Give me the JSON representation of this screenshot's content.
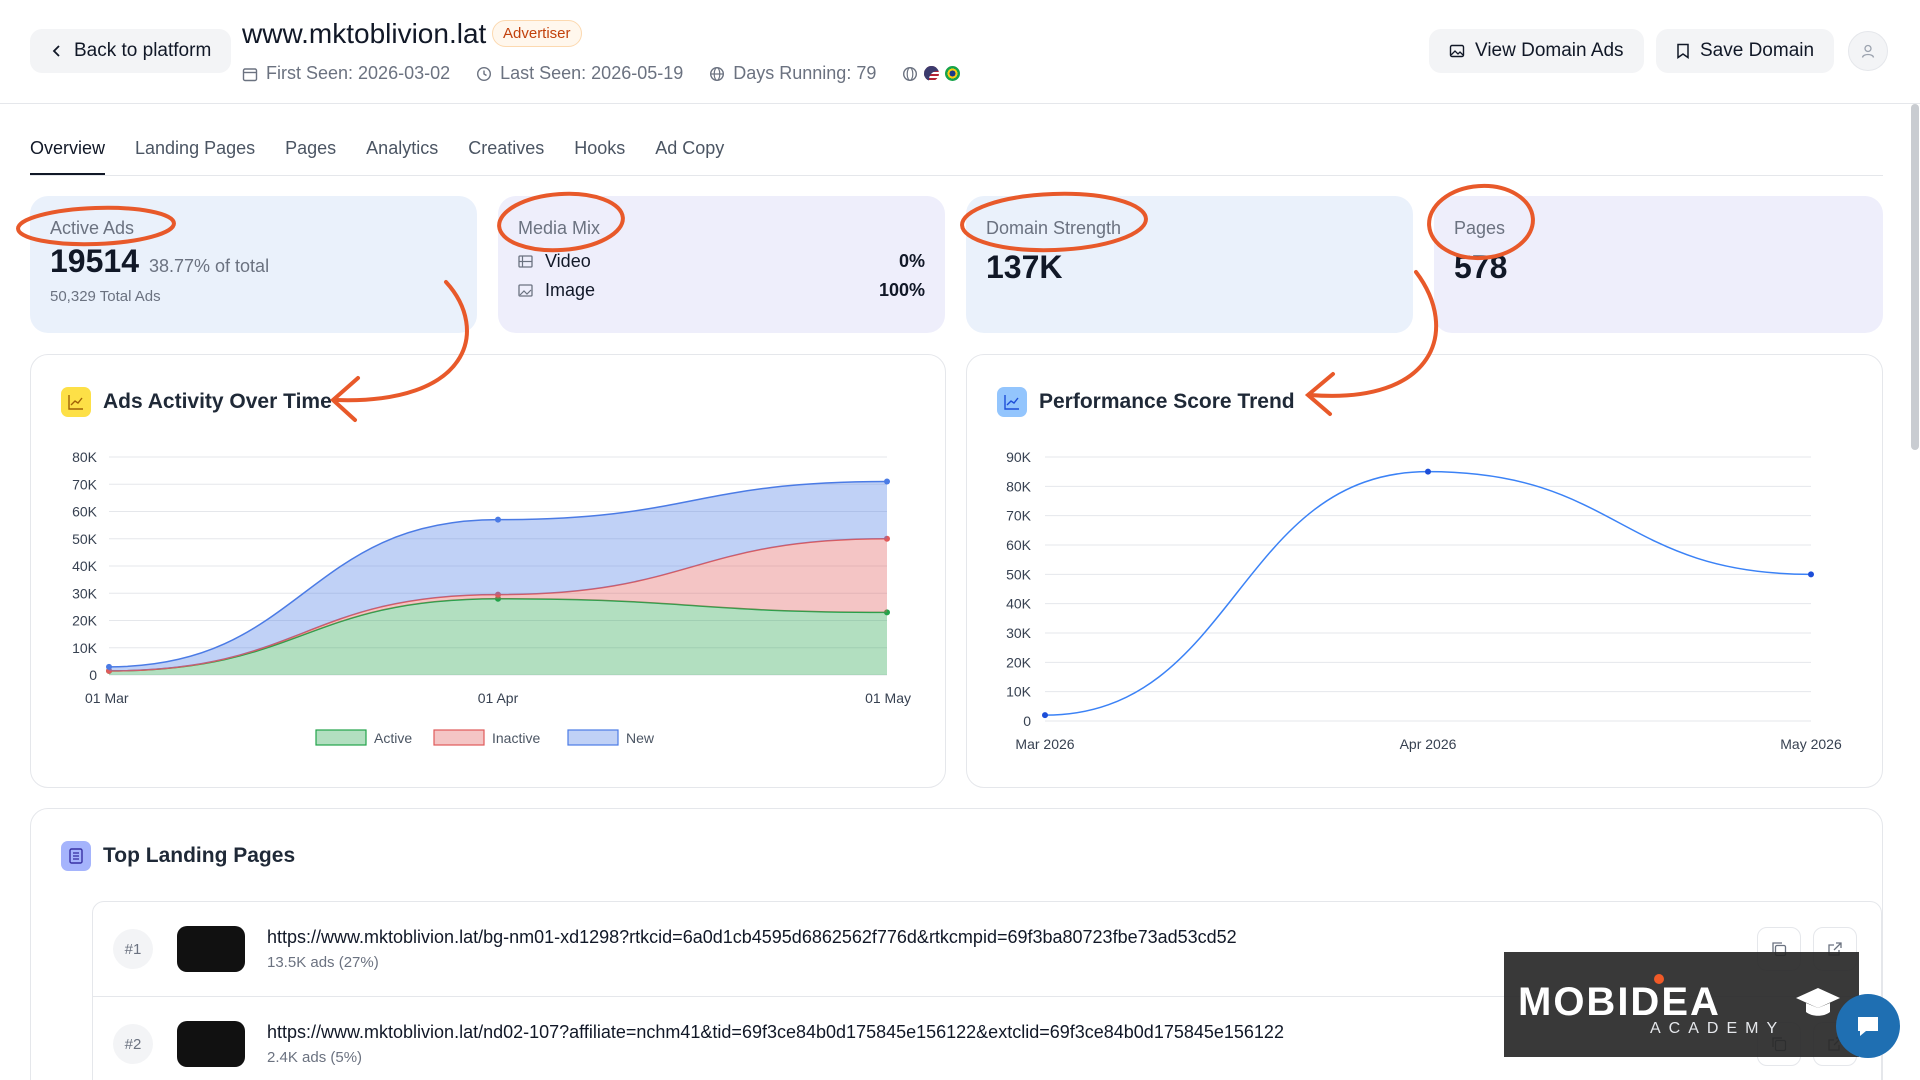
{
  "header": {
    "back_label": "Back to platform",
    "domain": "www.mktoblivion.lat",
    "badge": "Advertiser",
    "first_seen": "First Seen: 2026-03-02",
    "last_seen": "Last Seen: 2026-05-19",
    "days_running": "Days Running: 79",
    "view_ads_label": "View Domain Ads",
    "save_label": "Save Domain"
  },
  "tabs": [
    "Overview",
    "Landing Pages",
    "Pages",
    "Analytics",
    "Creatives",
    "Hooks",
    "Ad Copy"
  ],
  "stats": {
    "active_ads": {
      "label": "Active Ads",
      "value": "19514",
      "pct": "38.77% of total",
      "total": "50,329 Total Ads"
    },
    "media_mix": {
      "label": "Media Mix",
      "rows": [
        {
          "label": "Video",
          "value": "0%"
        },
        {
          "label": "Image",
          "value": "100%"
        }
      ]
    },
    "domain_strength": {
      "label": "Domain Strength",
      "value": "137K"
    },
    "pages": {
      "label": "Pages",
      "value": "578"
    }
  },
  "panels": {
    "ads_activity_title": "Ads Activity Over Time",
    "performance_title": "Performance Score Trend",
    "landing_title": "Top Landing Pages"
  },
  "chart_data": [
    {
      "type": "area",
      "title": "Ads Activity Over Time",
      "categories": [
        "01 Mar",
        "01 Apr",
        "01 May"
      ],
      "ylim": [
        0,
        80000
      ],
      "yticks": [
        "0",
        "10K",
        "20K",
        "30K",
        "40K",
        "50K",
        "60K",
        "70K",
        "80K"
      ],
      "stacked": true,
      "legend": "bottom",
      "grid": true,
      "series": [
        {
          "name": "Active",
          "values": [
            1500,
            28000,
            23000
          ],
          "color": "#22a34a"
        },
        {
          "name": "Inactive",
          "values": [
            0,
            1500,
            27000
          ],
          "color": "#e05a5a"
        },
        {
          "name": "New",
          "values": [
            1500,
            27500,
            21000
          ],
          "color": "#4b7be5"
        }
      ]
    },
    {
      "type": "line",
      "title": "Performance Score Trend",
      "categories": [
        "Mar 2026",
        "Apr 2026",
        "May 2026"
      ],
      "ylim": [
        0,
        90000
      ],
      "yticks": [
        "0",
        "10K",
        "20K",
        "30K",
        "40K",
        "50K",
        "60K",
        "70K",
        "80K",
        "90K"
      ],
      "grid": true,
      "series": [
        {
          "values": [
            2000,
            85000,
            50000
          ],
          "color": "#3b82f6"
        }
      ]
    }
  ],
  "landing_pages": [
    {
      "rank": "#1",
      "url": "https://www.mktoblivion.lat/bg-nm01-xd1298?rtkcid=6a0d1cb4595d6862562f776d&rtkcmpid=69f3ba80723fbe73ad53cd52",
      "sub": "13.5K ads (27%)"
    },
    {
      "rank": "#2",
      "url": "https://www.mktoblivion.lat/nd02-107?affiliate=nchm41&tid=69f3ce84b0d175845e156122&extclid=69f3ce84b0d175845e156122",
      "sub": "2.4K ads (5%)"
    }
  ],
  "watermark": {
    "brand": "MOBIDEA",
    "sub": "ACADEMY"
  },
  "colors": {
    "annotation": "#e8592a",
    "card_blue": "#eaf1fb",
    "card_lavender": "#eeeefb"
  }
}
